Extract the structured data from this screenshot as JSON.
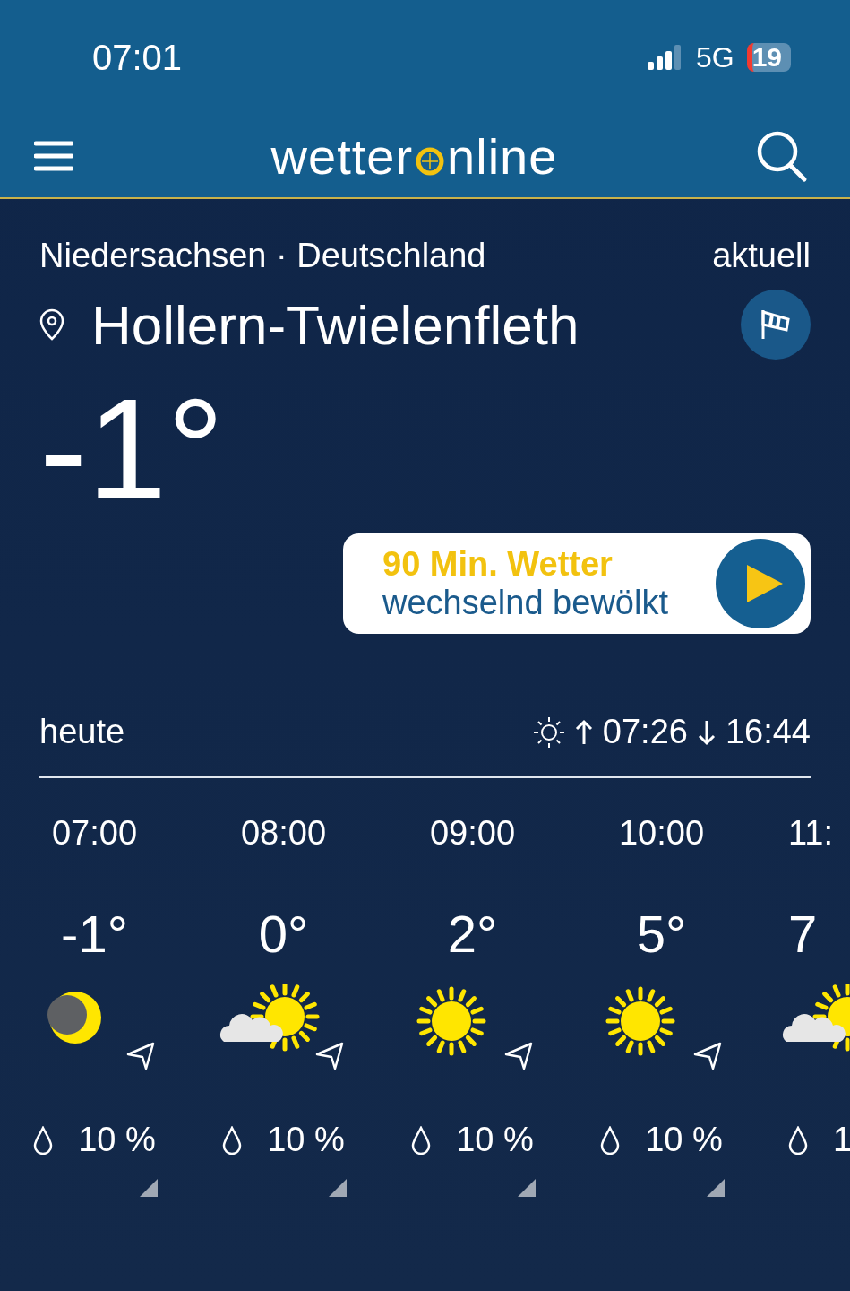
{
  "status_bar": {
    "time": "07:01",
    "network": "5G",
    "battery": "19"
  },
  "header": {
    "logo": [
      "wetter",
      "nline"
    ]
  },
  "location": {
    "region": "Niedersachsen · Deutschland",
    "mode": "aktuell",
    "city": "Hollern-Twielenfleth",
    "temperature": "-1°"
  },
  "forecast_card": {
    "title": "90 Min. Wetter",
    "subtitle": "wechselnd bewölkt"
  },
  "today": {
    "label": "heute",
    "sunrise": "07:26",
    "sunset": "16:44"
  },
  "hours": [
    {
      "time": "07:00",
      "temp": "-1°",
      "kind": "moon",
      "precip": "10 %"
    },
    {
      "time": "08:00",
      "temp": "0°",
      "kind": "cloud-sun",
      "precip": "10 %"
    },
    {
      "time": "09:00",
      "temp": "2°",
      "kind": "sun",
      "precip": "10 %"
    },
    {
      "time": "10:00",
      "temp": "5°",
      "kind": "sun",
      "precip": "10 %"
    },
    {
      "time": "11:",
      "temp": "7",
      "kind": "cloud-sun",
      "precip": "1"
    }
  ]
}
